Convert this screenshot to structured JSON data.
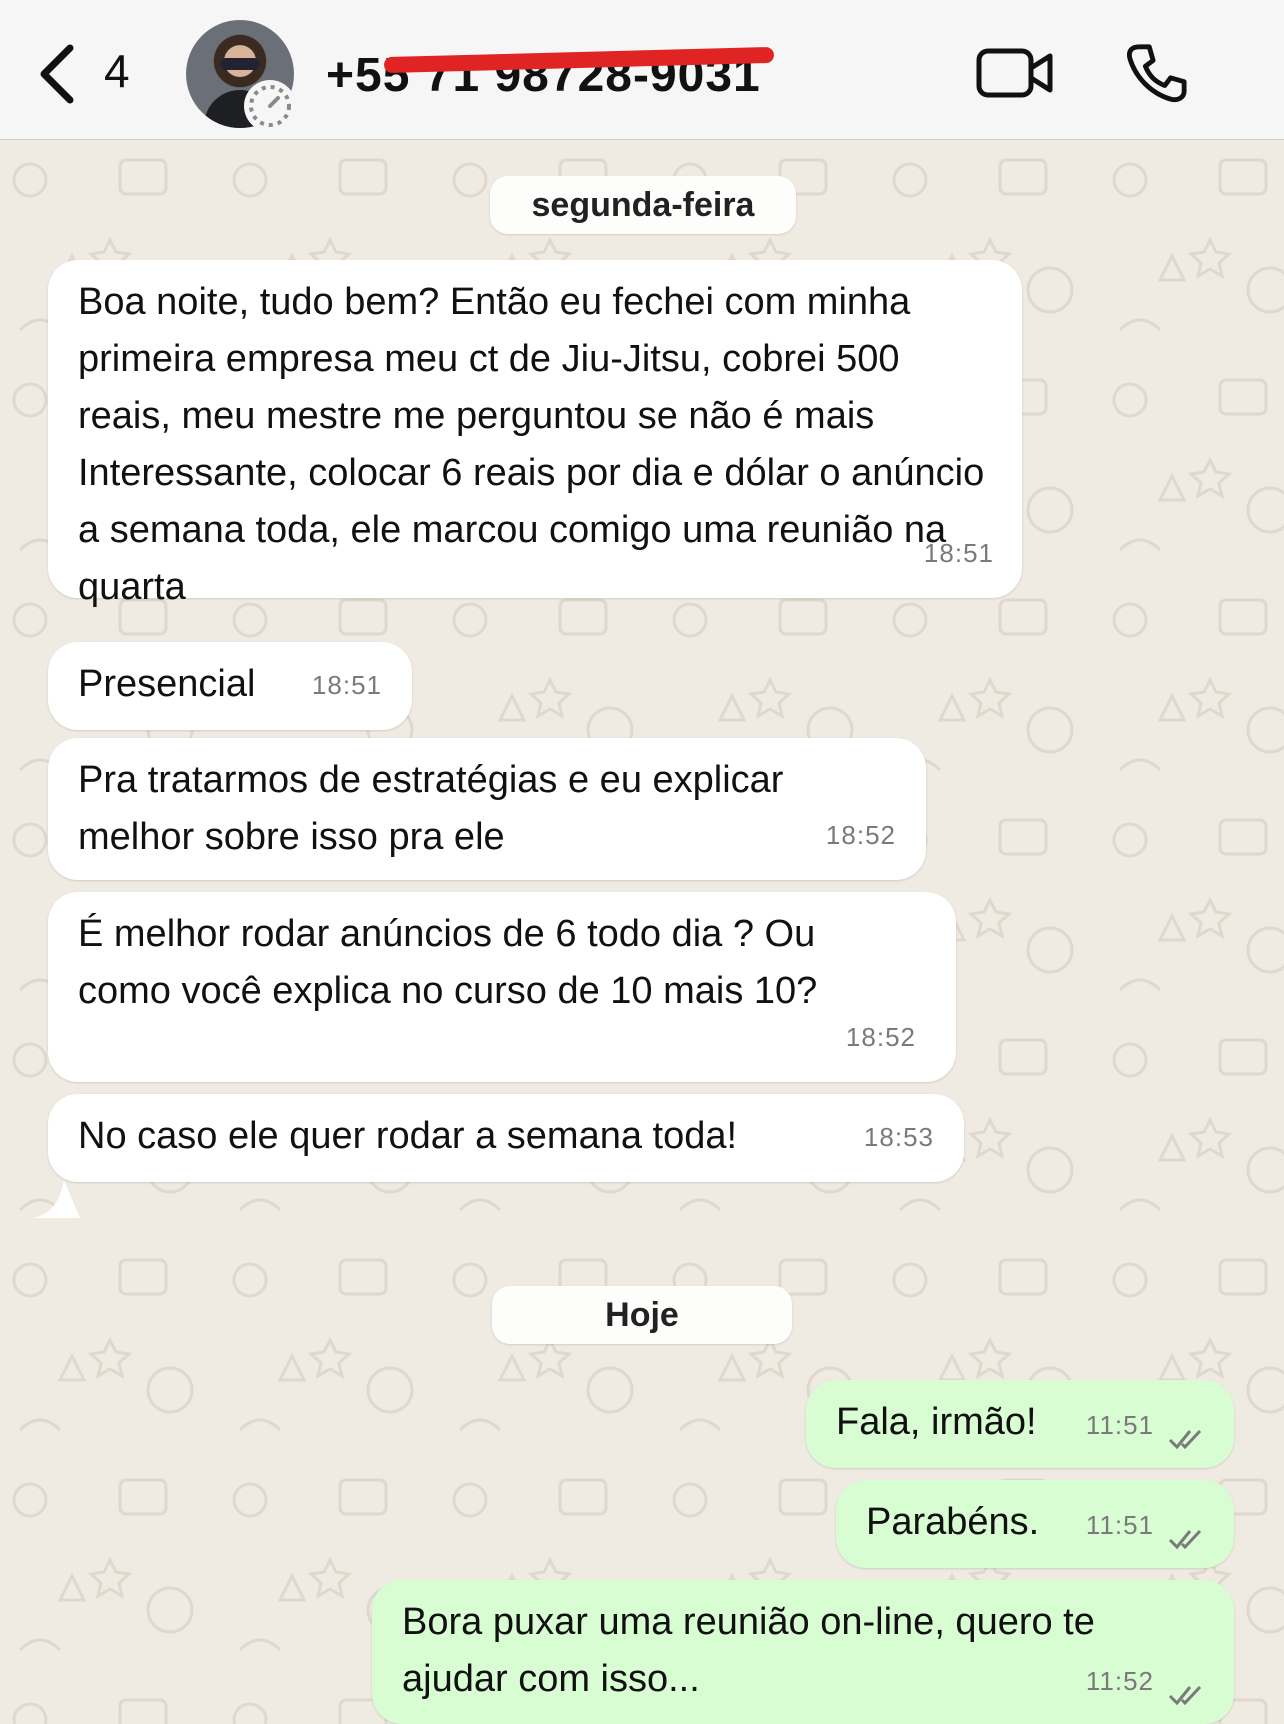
{
  "header": {
    "back_count": "4",
    "contact_name": "+55 71 98728-9031"
  },
  "dates": {
    "first": "segunda-feira",
    "second": "Hoje"
  },
  "messages": [
    {
      "direction": "in",
      "text": "Boa noite, tudo bem? Então eu fechei com minha primeira empresa meu ct de Jiu-Jitsu, cobrei 500 reais, meu mestre me perguntou se não é mais Interessante, colocar 6 reais por dia e dólar o anúncio a semana toda, ele marcou comigo uma reunião na quarta",
      "time": "18:51"
    },
    {
      "direction": "in",
      "text": "Presencial",
      "time": "18:51"
    },
    {
      "direction": "in",
      "text": "Pra tratarmos de estratégias e eu explicar melhor sobre isso pra ele",
      "time": "18:52"
    },
    {
      "direction": "in",
      "text": "É melhor rodar anúncios de 6 todo dia ? Ou como você explica no curso de 10 mais 10?",
      "time": "18:52"
    },
    {
      "direction": "in",
      "text": "No caso ele quer rodar a semana toda!",
      "time": "18:53"
    },
    {
      "direction": "out",
      "text": "Fala, irmão!",
      "time": "11:51",
      "status": "read"
    },
    {
      "direction": "out",
      "text": "Parabéns.",
      "time": "11:51",
      "status": "read"
    },
    {
      "direction": "out",
      "text": "Bora puxar uma reunião on-line, quero te ajudar com isso...",
      "time": "11:52",
      "status": "read"
    }
  ],
  "icons": {
    "back": "chevron-left-icon",
    "status": "status-ring-icon",
    "video": "video-camera-icon",
    "phone": "phone-icon",
    "read": "double-check-icon"
  },
  "colors": {
    "incoming_bubble": "#ffffff",
    "outgoing_bubble": "#d9fdd3",
    "wallpaper": "#efeae2",
    "redaction": "#e02424"
  }
}
